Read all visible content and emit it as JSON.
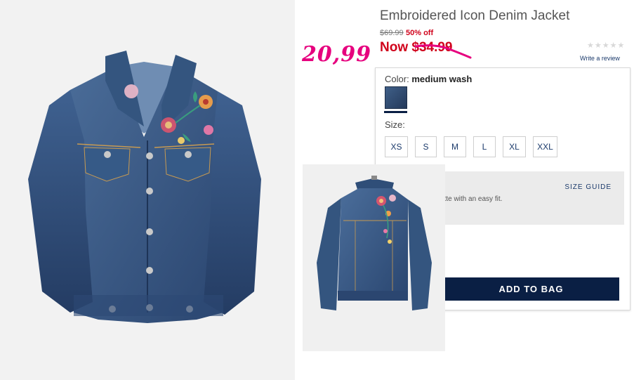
{
  "product": {
    "title": "Embroidered Icon Denim Jacket",
    "original_price": "$69.99",
    "discount": "50% off",
    "now_price": "Now $34.99",
    "handwritten_price": "20,99",
    "rating_stars": "★★★★★",
    "rating_filled": 0,
    "write_review": "Write a review"
  },
  "options": {
    "color_label": "Color:",
    "color_value": "medium wash",
    "swatch_color": "#3a5680",
    "size_label": "Size:",
    "sizes": [
      "XS",
      "S",
      "M",
      "L",
      "XL",
      "XXL"
    ],
    "size_guide": "SIZE GUIDE",
    "description_fragment": "ette with an easy fit.",
    "add_to_bag": "ADD TO BAG"
  },
  "colors": {
    "title_text": "#555555",
    "sale_red": "#d0021b",
    "handwritten_pink": "#e6007e",
    "navy": "#0a1f44",
    "link_blue": "#1b3a6b",
    "denim": "#3a5680"
  }
}
